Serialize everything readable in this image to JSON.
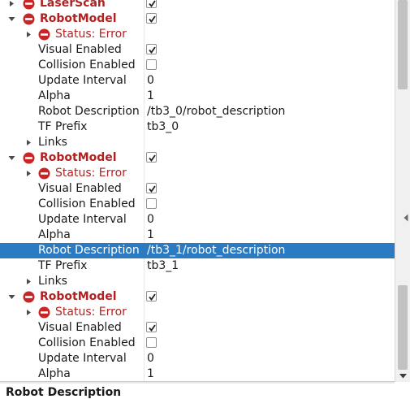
{
  "rows": [
    {
      "label": "LaserScan",
      "display": true,
      "checked": true
    },
    {
      "label": "RobotModel",
      "display": true,
      "checked": true
    },
    {
      "label": "Status: Error"
    },
    {
      "label": "Visual Enabled",
      "checked": true
    },
    {
      "label": "Collision Enabled",
      "checked": false
    },
    {
      "label": "Update Interval",
      "value": "0"
    },
    {
      "label": "Alpha",
      "value": "1"
    },
    {
      "label": "Robot Description",
      "value": "/tb3_0/robot_description"
    },
    {
      "label": "TF Prefix",
      "value": "tb3_0"
    },
    {
      "label": "Links"
    },
    {
      "label": "RobotModel",
      "display": true,
      "checked": true
    },
    {
      "label": "Status: Error"
    },
    {
      "label": "Visual Enabled",
      "checked": true
    },
    {
      "label": "Collision Enabled",
      "checked": false
    },
    {
      "label": "Update Interval",
      "value": "0"
    },
    {
      "label": "Alpha",
      "value": "1"
    },
    {
      "label": "Robot Description",
      "value": "/tb3_1/robot_description",
      "selected": true
    },
    {
      "label": "TF Prefix",
      "value": "tb3_1"
    },
    {
      "label": "Links"
    },
    {
      "label": "RobotModel",
      "display": true,
      "checked": true
    },
    {
      "label": "Status: Error"
    },
    {
      "label": "Visual Enabled",
      "checked": true
    },
    {
      "label": "Collision Enabled",
      "checked": false
    },
    {
      "label": "Update Interval",
      "value": "0"
    },
    {
      "label": "Alpha",
      "value": "1"
    }
  ],
  "description_panel": {
    "title": "Robot Description"
  },
  "colors": {
    "error": "#b02222",
    "selection": "#2b7bc2"
  }
}
